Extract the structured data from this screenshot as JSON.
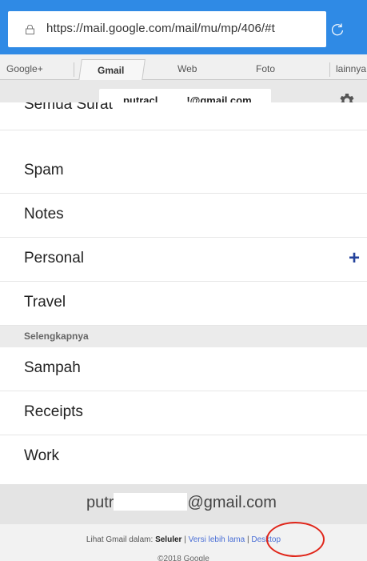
{
  "browser": {
    "url": "https://mail.google.com/mail/mu/mp/406/#t"
  },
  "tabs": [
    {
      "label": "Google+"
    },
    {
      "label": "Gmail",
      "active": true
    },
    {
      "label": "Web"
    },
    {
      "label": "Foto"
    },
    {
      "label": "lainnya"
    }
  ],
  "account": {
    "email_prefix": "putracl",
    "email_suffix": "!@gmail.com"
  },
  "labels": {
    "partial": "Semua Surat",
    "items": [
      "Spam",
      "Notes",
      "Personal",
      "Travel"
    ],
    "section": "Selengkapnya",
    "more_items": [
      "Sampah",
      "Receipts",
      "Work"
    ]
  },
  "footer": {
    "email_prefix": "putr",
    "email_suffix": "@gmail.com",
    "view_prefix": "Lihat Gmail dalam:",
    "mode_current": "Seluler",
    "sep": "|",
    "mode_old": "Versi lebih lama",
    "mode_desktop": "Desktop",
    "copyright": "©2018 Google"
  },
  "colors": {
    "browser_bar": "#2f8ae5",
    "plus_icon": "#23419b",
    "link": "#4a6fd6",
    "annotation_circle": "#e0261a"
  },
  "icons": [
    "lock-icon",
    "reload-icon",
    "gear-icon",
    "plus-icon"
  ]
}
